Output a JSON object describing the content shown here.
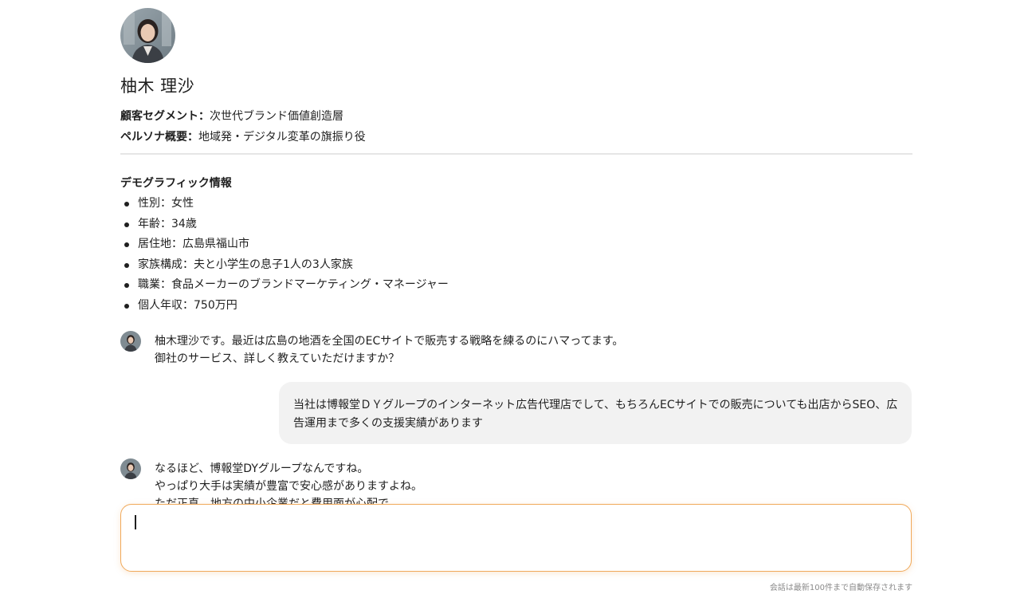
{
  "persona": {
    "name": "柚木 理沙",
    "segment_label": "顧客セグメント：",
    "segment_value": "次世代ブランド価値創造層",
    "overview_label": "ペルソナ概要：",
    "overview_value": "地域発・デジタル変革の旗振り役"
  },
  "demographics": {
    "title": "デモグラフィック情報",
    "items": [
      "性別：女性",
      "年齢：34歳",
      "居住地：広島県福山市",
      "家族構成：夫と小学生の息子1人の3人家族",
      "職業：食品メーカーのブランドマーケティング・マネージャー",
      "個人年収：750万円"
    ]
  },
  "chat": {
    "persona_message_1": [
      "柚木理沙です。最近は広島の地酒を全国のECサイトで販売する戦略を練るのにハマってます。",
      "御社のサービス、詳しく教えていただけますか？"
    ],
    "user_message_1": "当社は博報堂ＤＹグループのインターネット広告代理店でして、もちろんECサイトでの販売についても出店からSEO、広告運用まで多くの支援実績があります",
    "persona_message_2": [
      "なるほど、博報堂DYグループなんですね。",
      "やっぱり大手は実績が豊富で安心感がありますよね。",
      "ただ正直、地方の中小企業だと費用面が心配で。"
    ]
  },
  "input": {
    "value": "",
    "placeholder": ""
  },
  "footer": {
    "autosave_note": "会話は最新100件まで自動保存されます"
  },
  "colors": {
    "input_border": "#f0a95a",
    "user_bubble": "#f2f2f2",
    "divider": "#e6e6e6"
  },
  "icons": {
    "avatar": "persona-avatar-photo"
  }
}
